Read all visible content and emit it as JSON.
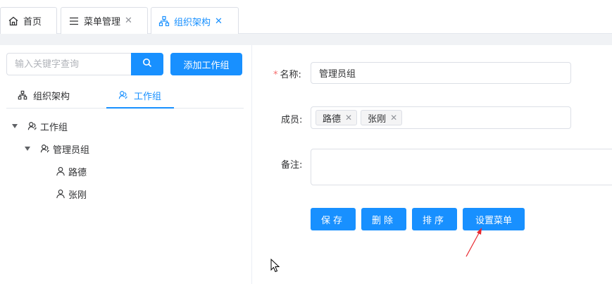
{
  "tabs": [
    {
      "label": "首页",
      "icon": "home-icon"
    },
    {
      "label": "菜单管理",
      "icon": "menu-icon",
      "closable": true
    },
    {
      "label": "组织架构",
      "icon": "org-icon",
      "closable": true,
      "active": true
    }
  ],
  "sidebar": {
    "search_placeholder": "输入关键字查询",
    "add_label": "添加工作组",
    "tabs": [
      {
        "label": "组织架构",
        "icon": "org-icon"
      },
      {
        "label": "工作组",
        "icon": "group-icon",
        "active": true
      }
    ],
    "tree": {
      "root": "工作组",
      "group": "管理员组",
      "members": [
        "路德",
        "张刚"
      ]
    }
  },
  "form": {
    "name_label": "名称:",
    "name_value": "管理员组",
    "members_label": "成员:",
    "members": [
      "路德",
      "张刚"
    ],
    "remark_label": "备注:",
    "remark_value": "",
    "buttons": {
      "save": "保存",
      "delete": "删除",
      "sort": "排序",
      "set_menu": "设置菜单"
    }
  },
  "colors": {
    "primary": "#1890ff",
    "required": "#f56c6c",
    "annotation_arrow": "#e8262d"
  }
}
